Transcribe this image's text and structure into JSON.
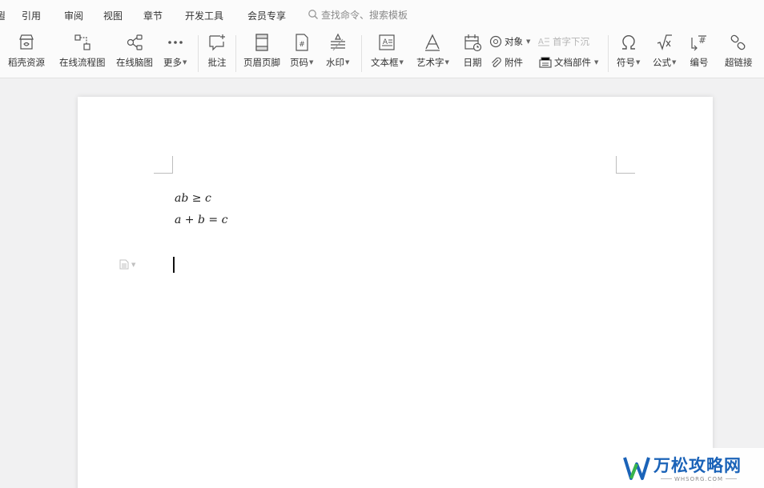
{
  "tabs": [
    {
      "label": "引用"
    },
    {
      "label": "审阅"
    },
    {
      "label": "视图"
    },
    {
      "label": "章节"
    },
    {
      "label": "开发工具"
    },
    {
      "label": "会员专享"
    }
  ],
  "search": {
    "placeholder": "查找命令、搜索模板",
    "icon": "search-icon"
  },
  "ribbon": {
    "buttons": [
      {
        "label": "稻壳资源",
        "icon": "store-icon"
      },
      {
        "label": "在线流程图",
        "icon": "flowchart-icon"
      },
      {
        "label": "在线脑图",
        "icon": "mindmap-icon"
      },
      {
        "label": "更多",
        "icon": "more-icon"
      },
      {
        "label": "批注",
        "icon": "comment-icon"
      },
      {
        "label": "页眉页脚",
        "icon": "header-footer-icon"
      },
      {
        "label": "页码",
        "icon": "page-number-icon"
      },
      {
        "label": "水印",
        "icon": "watermark-icon"
      },
      {
        "label": "文本框",
        "icon": "textbox-icon"
      },
      {
        "label": "艺术字",
        "icon": "wordart-icon"
      },
      {
        "label": "日期",
        "icon": "date-icon"
      },
      {
        "label": "符号",
        "icon": "omega-icon"
      },
      {
        "label": "公式",
        "icon": "formula-icon"
      },
      {
        "label": "编号",
        "icon": "numbering-icon"
      },
      {
        "label": "超链接",
        "icon": "link-icon"
      }
    ],
    "small": {
      "object": "对象",
      "dropcap": "首字下沉",
      "attachment": "附件",
      "docparts": "文档部件"
    }
  },
  "document": {
    "equation1": "ab ≥ c",
    "equation2": "a + b = c"
  },
  "watermark": {
    "title": "万松攻略网",
    "domain": "WHSORG.COM"
  }
}
